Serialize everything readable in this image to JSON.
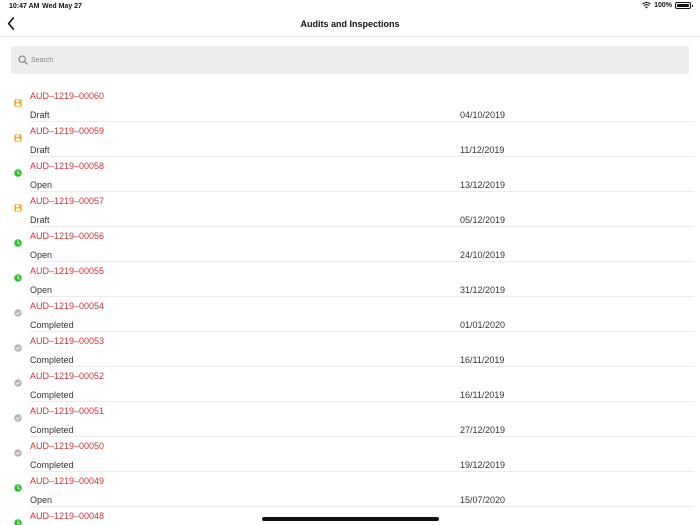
{
  "status_bar": {
    "time": "10:47 AM",
    "date": "Wed May 27",
    "battery": "100%",
    "battery_level": 1.0
  },
  "nav": {
    "title": "Audits and Inspections",
    "back_icon": "chevron-left-icon"
  },
  "search": {
    "placeholder": "Search",
    "value": ""
  },
  "colors": {
    "code_text": "#c8323c",
    "draft": "#f5a623",
    "open": "#2ec12e",
    "completed": "#b5b5b5"
  },
  "items": [
    {
      "code": "AUD–1219–00060",
      "status": "Draft",
      "date": "04/10/2019",
      "icon": "draft-save-icon"
    },
    {
      "code": "AUD–1219–00059",
      "status": "Draft",
      "date": "11/12/2019",
      "icon": "draft-save-icon"
    },
    {
      "code": "AUD–1219–00058",
      "status": "Open",
      "date": "13/12/2019",
      "icon": "open-clock-icon"
    },
    {
      "code": "AUD–1219–00057",
      "status": "Draft",
      "date": "05/12/2019",
      "icon": "draft-save-icon"
    },
    {
      "code": "AUD–1219–00056",
      "status": "Open",
      "date": "24/10/2019",
      "icon": "open-clock-icon"
    },
    {
      "code": "AUD–1219–00055",
      "status": "Open",
      "date": "31/12/2019",
      "icon": "open-clock-icon"
    },
    {
      "code": "AUD–1219–00054",
      "status": "Completed",
      "date": "01/01/2020",
      "icon": "completed-check-icon"
    },
    {
      "code": "AUD–1219–00053",
      "status": "Completed",
      "date": "16/11/2019",
      "icon": "completed-check-icon"
    },
    {
      "code": "AUD–1219–00052",
      "status": "Completed",
      "date": "16/11/2019",
      "icon": "completed-check-icon"
    },
    {
      "code": "AUD–1219–00051",
      "status": "Completed",
      "date": "27/12/2019",
      "icon": "completed-check-icon"
    },
    {
      "code": "AUD–1219–00050",
      "status": "Completed",
      "date": "19/12/2019",
      "icon": "completed-check-icon"
    },
    {
      "code": "AUD–1219–00049",
      "status": "Open",
      "date": "15/07/2020",
      "icon": "open-clock-icon"
    },
    {
      "code": "AUD–1219–00048",
      "status": "",
      "date": "",
      "icon": "open-clock-icon"
    }
  ]
}
